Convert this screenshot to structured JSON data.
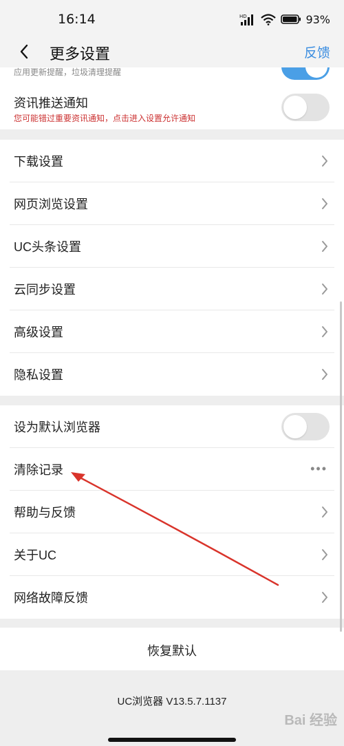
{
  "status_bar": {
    "time": "16:14",
    "battery": "93%",
    "icons": [
      "hd-signal-icon",
      "wifi-icon",
      "battery-icon"
    ]
  },
  "header": {
    "title": "更多设置",
    "action": "反馈",
    "back_icon": "chevron-left-icon"
  },
  "top_section": {
    "partial_subtitle": "应用更新提醒，垃圾清理提醒",
    "partial_toggle_on": true,
    "push_title": "资讯推送通知",
    "push_warning": "您可能错过重要资讯通知，点击进入设置允许通知",
    "push_toggle_on": false
  },
  "settings_items": [
    {
      "label": "下载设置"
    },
    {
      "label": "网页浏览设置"
    },
    {
      "label": "UC头条设置"
    },
    {
      "label": "云同步设置"
    },
    {
      "label": "高级设置"
    },
    {
      "label": "隐私设置"
    }
  ],
  "misc_items": [
    {
      "label": "设为默认浏览器",
      "control": "toggle",
      "value": false
    },
    {
      "label": "清除记录",
      "control": "more"
    },
    {
      "label": "帮助与反馈",
      "control": "chevron"
    },
    {
      "label": "关于UC",
      "control": "chevron"
    },
    {
      "label": "网络故障反馈",
      "control": "chevron"
    }
  ],
  "restore_label": "恢复默认",
  "version": "UC浏览器 V13.5.7.1137",
  "watermark": "Bai 经验",
  "colors": {
    "accent": "#3b8de0",
    "warning": "#cc3333",
    "annotation_arrow": "#d9342b"
  }
}
